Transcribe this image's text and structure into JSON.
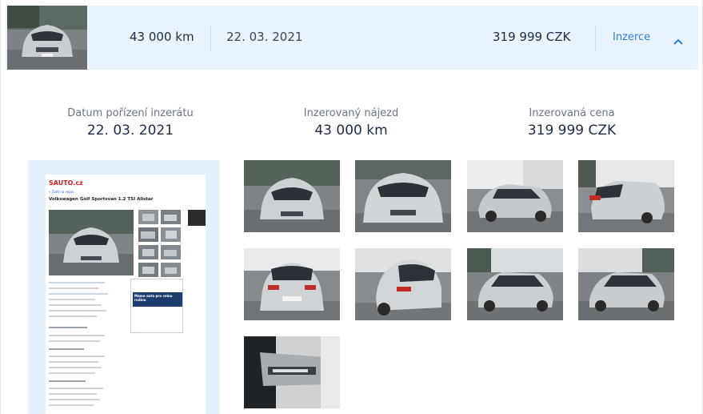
{
  "header": {
    "mileage": "43 000 km",
    "date": "22. 03. 2021",
    "price": "319 999 CZK",
    "link_label": "Inzerce"
  },
  "stats": [
    {
      "label": "Datum pořízení inzerátu",
      "value": "22. 03. 2021"
    },
    {
      "label": "Inzerovaný nájezd",
      "value": "43 000 km"
    },
    {
      "label": "Inzerovaná cena",
      "value": "319 999 CZK"
    }
  ],
  "ad_screenshot": {
    "logo": "SAUTO.cz",
    "back_link": "« Zpět na výpis",
    "title": "Volkswagen Golf Sportsvan 1.2 TSI Allstar",
    "ad_banner": "Máme auta pro celou rodinu"
  },
  "photos": [
    {
      "name": "front-view"
    },
    {
      "name": "front-close"
    },
    {
      "name": "front-left-side"
    },
    {
      "name": "rear-right"
    },
    {
      "name": "rear-view"
    },
    {
      "name": "rear-left"
    },
    {
      "name": "front-left-angle"
    },
    {
      "name": "front-left-angle-2"
    },
    {
      "name": "allstar-badge"
    }
  ],
  "colors": {
    "header_bg": "#e9f3fd",
    "link": "#2f7fd8",
    "text": "#1f2a44",
    "muted": "#6c7388",
    "panel_bg": "#e5f1fc"
  },
  "icons": {
    "collapse": "chevron-up-icon"
  }
}
